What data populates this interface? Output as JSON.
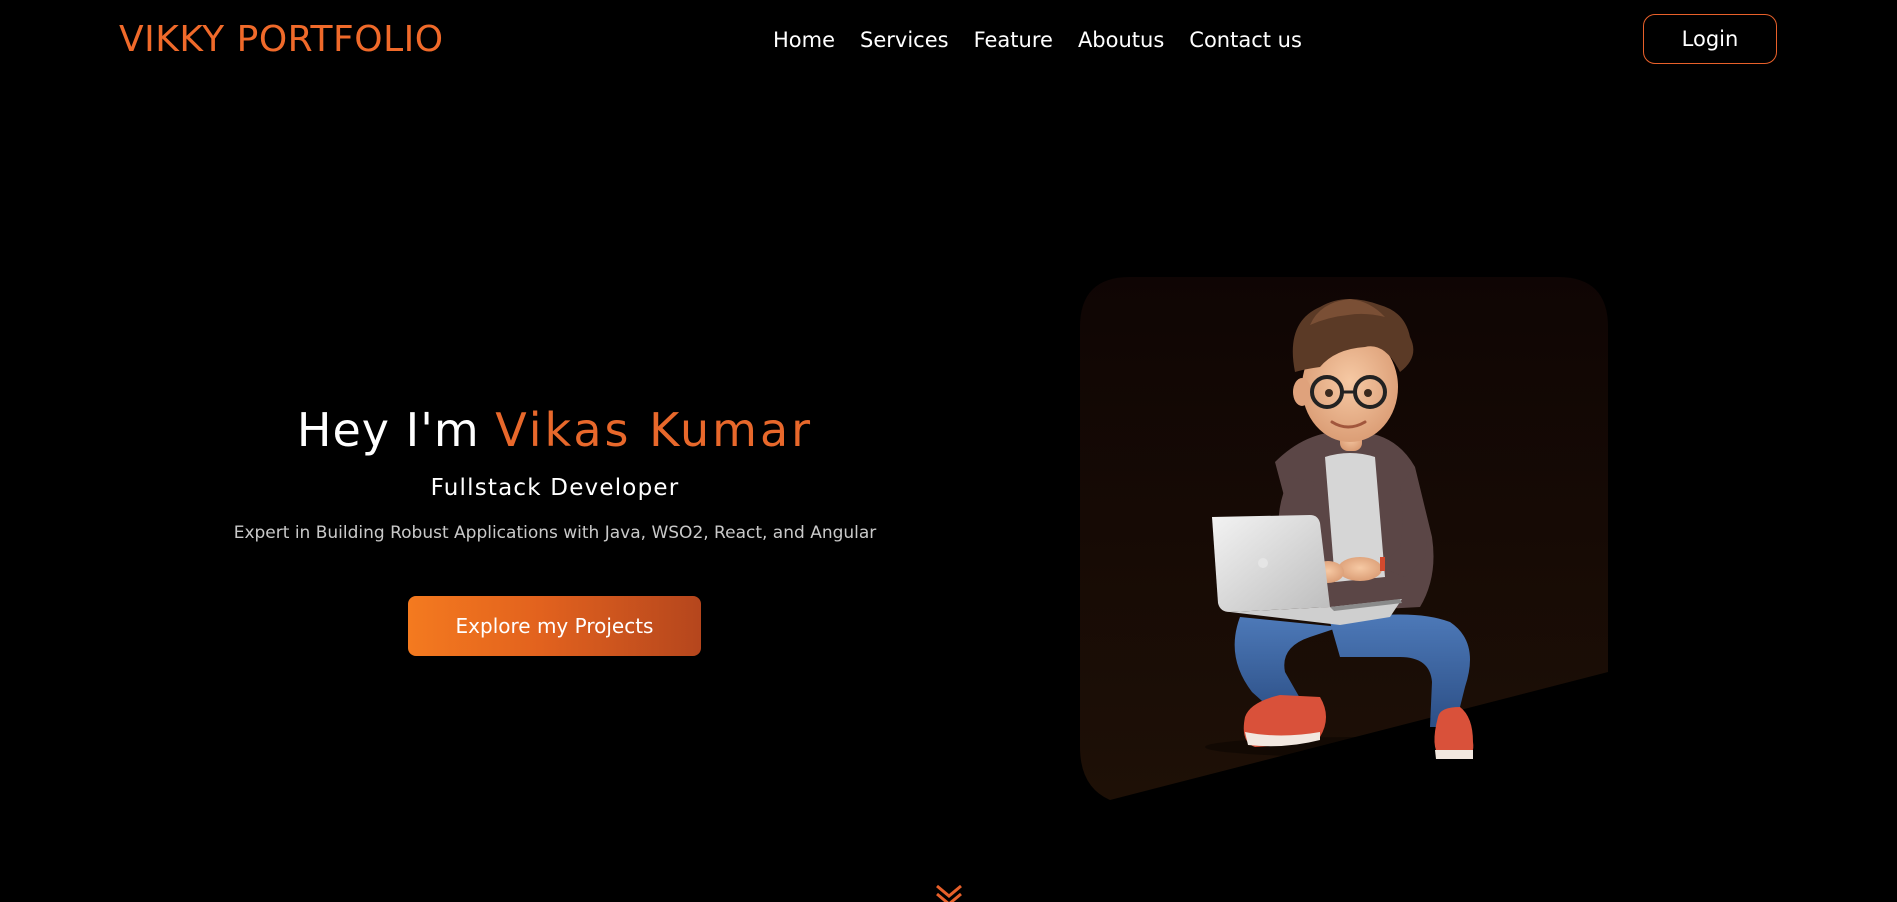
{
  "header": {
    "logo": "VIKKY PORTFOLIO",
    "nav": [
      "Home",
      "Services",
      "Feature",
      "Aboutus",
      "Contact us"
    ],
    "login_label": "Login"
  },
  "hero": {
    "greeting": "Hey I'm",
    "name": "Vikas Kumar",
    "role": "Fullstack Developer",
    "description": "Expert in Building Robust Applications with Java, WSO2, React, and Angular",
    "cta_label": "Explore my Projects",
    "image": "cartoon-developer-with-laptop"
  },
  "colors": {
    "background": "#000000",
    "accent": "#e8682b",
    "button_gradient_start": "#f47a1f",
    "button_gradient_end": "#b5461d"
  },
  "icons": {
    "scroll": "chevron-down-icon"
  }
}
